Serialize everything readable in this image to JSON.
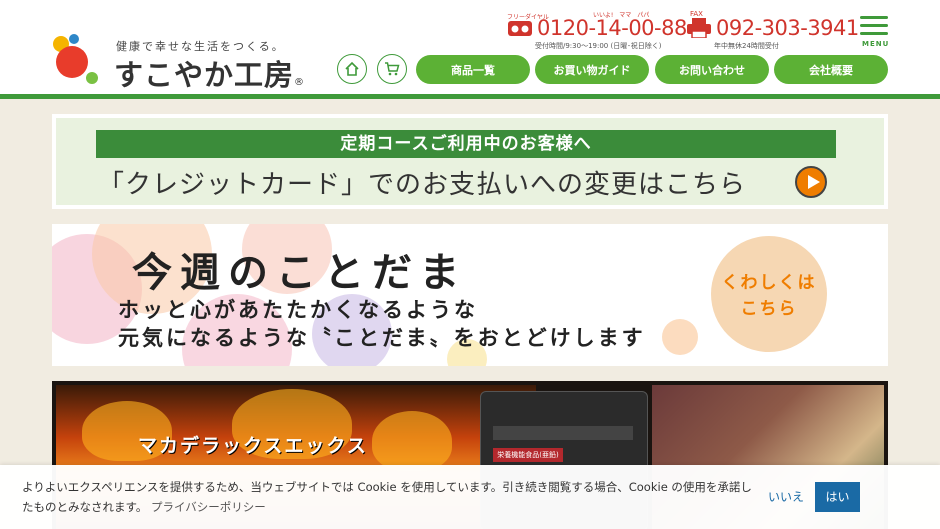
{
  "header": {
    "tagline": "健康で幸せな生活をつくる。",
    "brand": "すこやか工房",
    "reg_mark": "®",
    "phone_free": {
      "label": "フリーダイヤル",
      "reading": "いいよ!　ママ　パパ",
      "number": "0120-14-00-88",
      "hours": "受付時間/9:30〜19:00 (日曜･祝日除く)"
    },
    "fax": {
      "label": "FAX",
      "number": "092-303-3941",
      "hours": "年中無休24時間受付"
    },
    "menu_label": "MENU",
    "nav": [
      "商品一覧",
      "お買い物ガイド",
      "お問い合わせ",
      "会社概要"
    ],
    "icons": [
      "home-icon",
      "cart-icon"
    ]
  },
  "banners": {
    "credit": {
      "title": "定期コースご利用中のお客様へ",
      "text": "「クレジットカード」でのお支払いへの変更はこちら"
    },
    "kotodama": {
      "title": "今週のことだま",
      "line1": "ホッと心があたたかくなるような",
      "line2": "元気になるような〝ことだま〟をおとどけします",
      "detail_line1": "くわしくは",
      "detail_line2": "こちら"
    },
    "maca": {
      "title": "マカデラックスエックス",
      "pkg_label": "栄養機能食品(亜鉛)"
    }
  },
  "cookie": {
    "message": "よりよいエクスペリエンスを提供するため、当ウェブサイトでは Cookie を使用しています。引き続き閲覧する場合、Cookie の使用を承諾したものとみなされます。",
    "policy_link": "プライバシーポリシー",
    "no": "いいえ",
    "yes": "はい"
  },
  "colors": {
    "green": "#5cb135",
    "dark_green": "#3f9a3a",
    "red": "#d0342c",
    "orange": "#ef7d00",
    "blue": "#1a6aa5"
  }
}
